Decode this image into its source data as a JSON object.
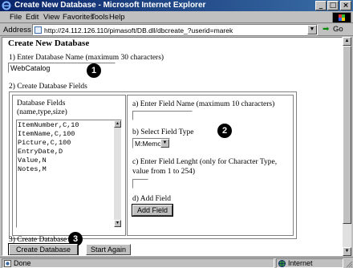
{
  "window": {
    "title": "Create New Database - Microsoft Internet Explorer",
    "minimize": "_",
    "maximize": "□",
    "close": "×"
  },
  "menu": [
    "File",
    "Edit",
    "View",
    "Favorites",
    "Tools",
    "Help"
  ],
  "address": {
    "label": "Address",
    "url": "http://24.112.126.110/pimasoft/DB.dll/dbcreate_?userid=marek",
    "go": "Go"
  },
  "page": {
    "title": "Create New Database",
    "step1_label": "1) Enter Database Name (maximum 30 characters)",
    "db_name_value": "WebCatalog",
    "step2_label": "2) Create Database Fields",
    "fields_caption_line1": "Database Fields",
    "fields_caption_line2": "(name,type,size)",
    "fields": [
      "ItemNumber,C,10",
      "ItemName,C,100",
      "Picture,C,100",
      "EntryDate,D",
      "Value,N",
      "Notes,M"
    ],
    "field_name_label": "a) Enter Field Name (maximum 10 characters)",
    "field_type_label": "b) Select Field Type",
    "field_type_value": "M:Memo",
    "field_length_label_line1": "c) Enter Field Lenght (only for Character Type,",
    "field_length_label_line2": "value from 1 to 254)",
    "add_field_label": "d) Add Field",
    "add_field_button": "Add Field",
    "step3_label": "3) Create Database",
    "create_button": "Create Database",
    "start_again_button": "Start Again"
  },
  "badges": [
    "1",
    "2",
    "3"
  ],
  "status": {
    "left": "Done",
    "zone": "Internet"
  },
  "colors": {
    "titlebar_start": "#0a246a",
    "titlebar_end": "#3a6ea5",
    "chrome": "#c0c0c0"
  }
}
